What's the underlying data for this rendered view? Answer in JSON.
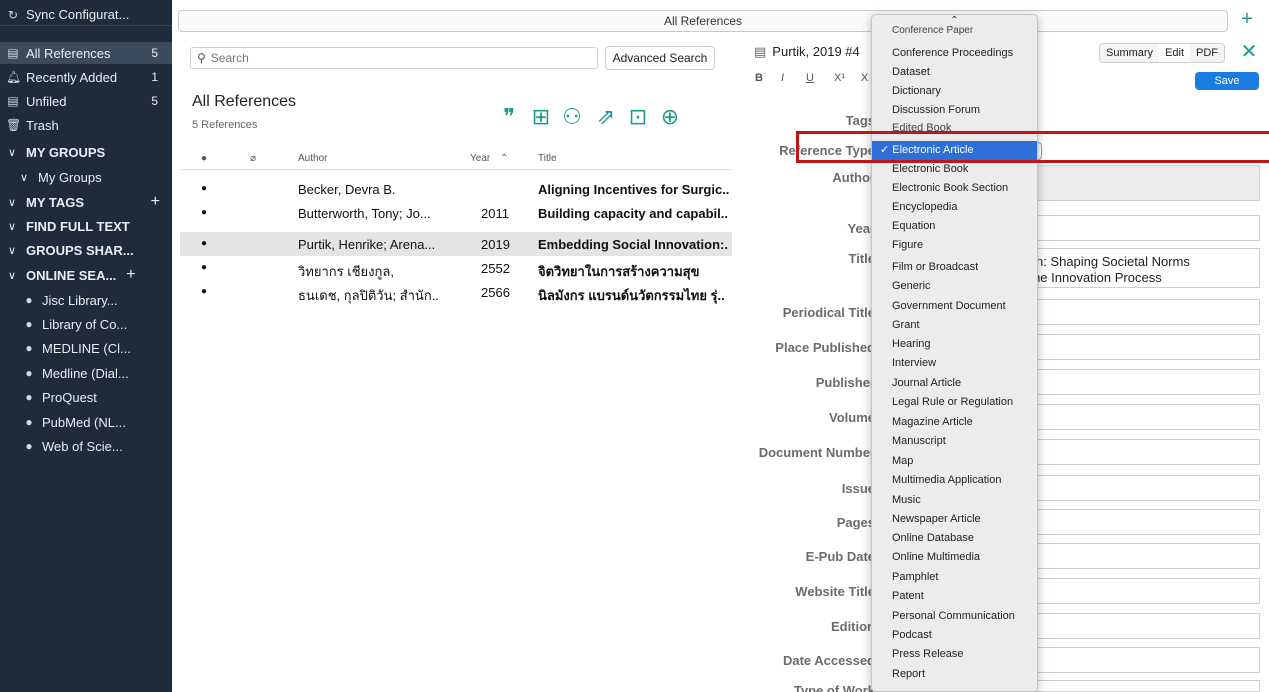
{
  "sidebar": {
    "sync": "Sync Configurat...",
    "items": [
      {
        "label": "All References",
        "count": "5"
      },
      {
        "label": "Recently Added",
        "count": "1"
      },
      {
        "label": "Unfiled",
        "count": "5"
      },
      {
        "label": "Trash",
        "count": ""
      }
    ],
    "sections": {
      "my_groups": "MY GROUPS",
      "my_groups_child": "My Groups",
      "my_tags": "MY TAGS",
      "find_full_text": "FIND FULL TEXT",
      "groups_shared": "GROUPS SHAR...",
      "online_search": "ONLINE SEA..."
    },
    "libraries": [
      "Jisc Library...",
      "Library of Co...",
      "MEDLINE (Cl...",
      "Medline (Dial...",
      "ProQuest",
      "PubMed (NL...",
      "Web of Scie..."
    ]
  },
  "topbar": {
    "title": "All References"
  },
  "list": {
    "search_placeholder": "Search",
    "advanced_search": "Advanced Search",
    "title": "All References",
    "subtitle": "5 References",
    "columns": {
      "author": "Author",
      "year": "Year",
      "title": "Title"
    },
    "rows": [
      {
        "author": "Becker, Devra B.",
        "year": "",
        "title": "Aligning Incentives for Surgic.."
      },
      {
        "author": "Butterworth, Tony; Jo...",
        "year": "2011",
        "title": "Building capacity and capabil.."
      },
      {
        "author": "Purtik, Henrike; Arena...",
        "year": "2019",
        "title": "Embedding Social Innovation:."
      },
      {
        "author": "วิทยากร เชียงกูล,",
        "year": "2552",
        "title": "จิตวิทยาในการสร้างความสุข"
      },
      {
        "author": "ธนเดช, กุลปิติวัน; สำนัก...",
        "year": "2566",
        "title": "นิลมังกร แบรนด์นวัตกรรมไทย รุ่.."
      }
    ]
  },
  "editor": {
    "ref_title": "Purtik, 2019 #4",
    "tabs": [
      "Summary",
      "Edit",
      "PDF"
    ],
    "save": "Save",
    "format": [
      "B",
      "I",
      "U",
      "X¹",
      "X"
    ],
    "labels": {
      "tags": "Tags",
      "reference_type": "Reference Type",
      "author": "Author",
      "year": "Year",
      "title": "Title",
      "periodical_title": "Periodical Title",
      "place_published": "Place Published",
      "publisher": "Publisher",
      "volume": "Volume",
      "document_number": "Document Number",
      "issue": "Issue",
      "pages": "Pages",
      "epub_date": "E-Pub Date",
      "website_title": "Website Title",
      "edition": "Edition",
      "date_accessed": "Date Accessed",
      "type_of_work": "Type of Work"
    },
    "title_value_line1": "ation: Shaping Societal Norms",
    "title_value_line2": "ut the Innovation Process"
  },
  "dropdown": {
    "items": [
      "Conference Paper",
      "Conference Proceedings",
      "Dataset",
      "Dictionary",
      "Discussion Forum",
      "Edited Book",
      "Electronic Article",
      "Electronic Book",
      "Electronic Book Section",
      "Encyclopedia",
      "Equation",
      "Figure",
      "Film or Broadcast",
      "Generic",
      "Government Document",
      "Grant",
      "Hearing",
      "Interview",
      "Journal Article",
      "Legal Rule or Regulation",
      "Magazine Article",
      "Manuscript",
      "Map",
      "Multimedia Application",
      "Music",
      "Newspaper Article",
      "Online Database",
      "Online Multimedia",
      "Pamphlet",
      "Patent",
      "Personal Communication",
      "Podcast",
      "Press Release",
      "Report"
    ],
    "selected": "✓ Electronic Article"
  },
  "colors": {
    "accent": "#1e9a8c",
    "sidebar": "#1e2b3a",
    "selection": "#2e6fd8",
    "highlight": "#c01616",
    "save": "#1a7ce0"
  }
}
